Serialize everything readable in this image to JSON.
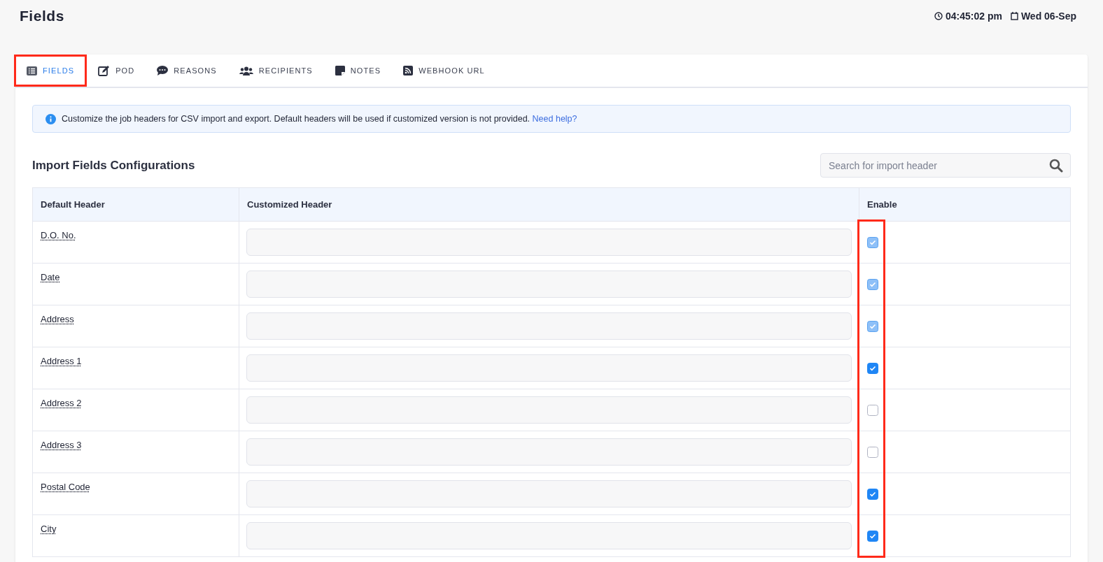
{
  "page": {
    "title": "Fields",
    "time": "04:45:02 pm",
    "date": "Wed 06-Sep"
  },
  "tabs": [
    {
      "label": "FIELDS",
      "selected": true,
      "highlighted": true
    },
    {
      "label": "POD",
      "selected": false,
      "highlighted": false
    },
    {
      "label": "REASONS",
      "selected": false,
      "highlighted": false
    },
    {
      "label": "RECIPIENTS",
      "selected": false,
      "highlighted": false
    },
    {
      "label": "NOTES",
      "selected": false,
      "highlighted": false
    },
    {
      "label": "WEBHOOK URL",
      "selected": false,
      "highlighted": false
    }
  ],
  "info": {
    "text": "Customize the job headers for CSV import and export. Default headers will be used if customized version is not provided.",
    "link": "Need help?"
  },
  "section": {
    "title": "Import Fields Configurations",
    "search": {
      "placeholder": "Search for import header"
    }
  },
  "table": {
    "columns": [
      "Default Header",
      "Customized Header",
      "Enable"
    ],
    "enable_column_highlighted": true,
    "rows": [
      {
        "header": "D.O. No.",
        "checked": true,
        "disabled": true
      },
      {
        "header": "Date",
        "checked": true,
        "disabled": true
      },
      {
        "header": "Address",
        "checked": true,
        "disabled": true
      },
      {
        "header": "Address 1",
        "checked": true,
        "disabled": false
      },
      {
        "header": "Address 2",
        "checked": false,
        "disabled": false
      },
      {
        "header": "Address 3",
        "checked": false,
        "disabled": false
      },
      {
        "header": "Postal Code",
        "checked": true,
        "disabled": false
      },
      {
        "header": "City",
        "checked": true,
        "disabled": false
      }
    ]
  }
}
